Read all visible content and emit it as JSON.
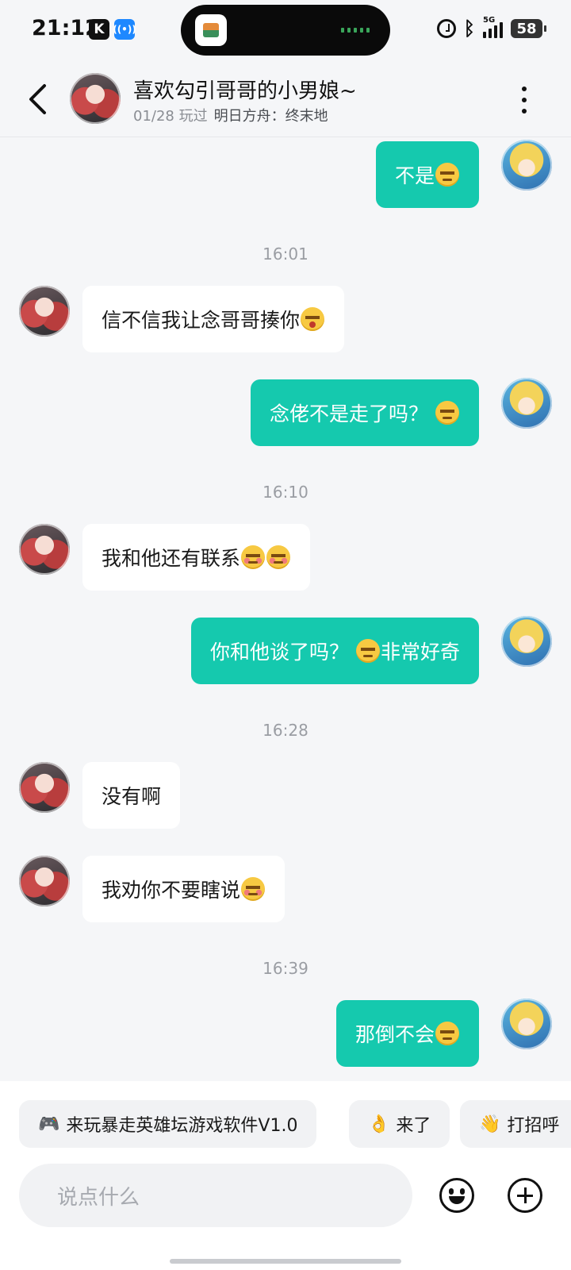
{
  "status_bar": {
    "time": "21:12",
    "battery": "58",
    "network": "5G"
  },
  "header": {
    "title": "喜欢勾引哥哥的小男娘~",
    "played": "01/28 玩过",
    "game": "明日方舟：终末地"
  },
  "messages": {
    "m1": "不是",
    "t1": "16:01",
    "m2": "信不信我让念哥哥揍你",
    "m3": "念佬不是走了吗？",
    "t2": "16:10",
    "m4": "我和他还有联系",
    "m5a": "你和他谈了吗？",
    "m5b": "非常好奇",
    "t3": "16:28",
    "m6": "没有啊",
    "m7": "我劝你不要瞎说",
    "t4": "16:39",
    "m8": "那倒不会"
  },
  "quick_replies": {
    "r1_icon": "🎮",
    "r1": "来玩暴走英雄坛游戏软件V1.0",
    "r2_icon": "👌",
    "r2": "来了",
    "r3_icon": "👋",
    "r3": "打招呼"
  },
  "composer": {
    "placeholder": "说点什么"
  },
  "colors": {
    "outgoing_bubble": "#15c9ae",
    "incoming_bubble": "#ffffff",
    "background": "#f5f6f8"
  }
}
